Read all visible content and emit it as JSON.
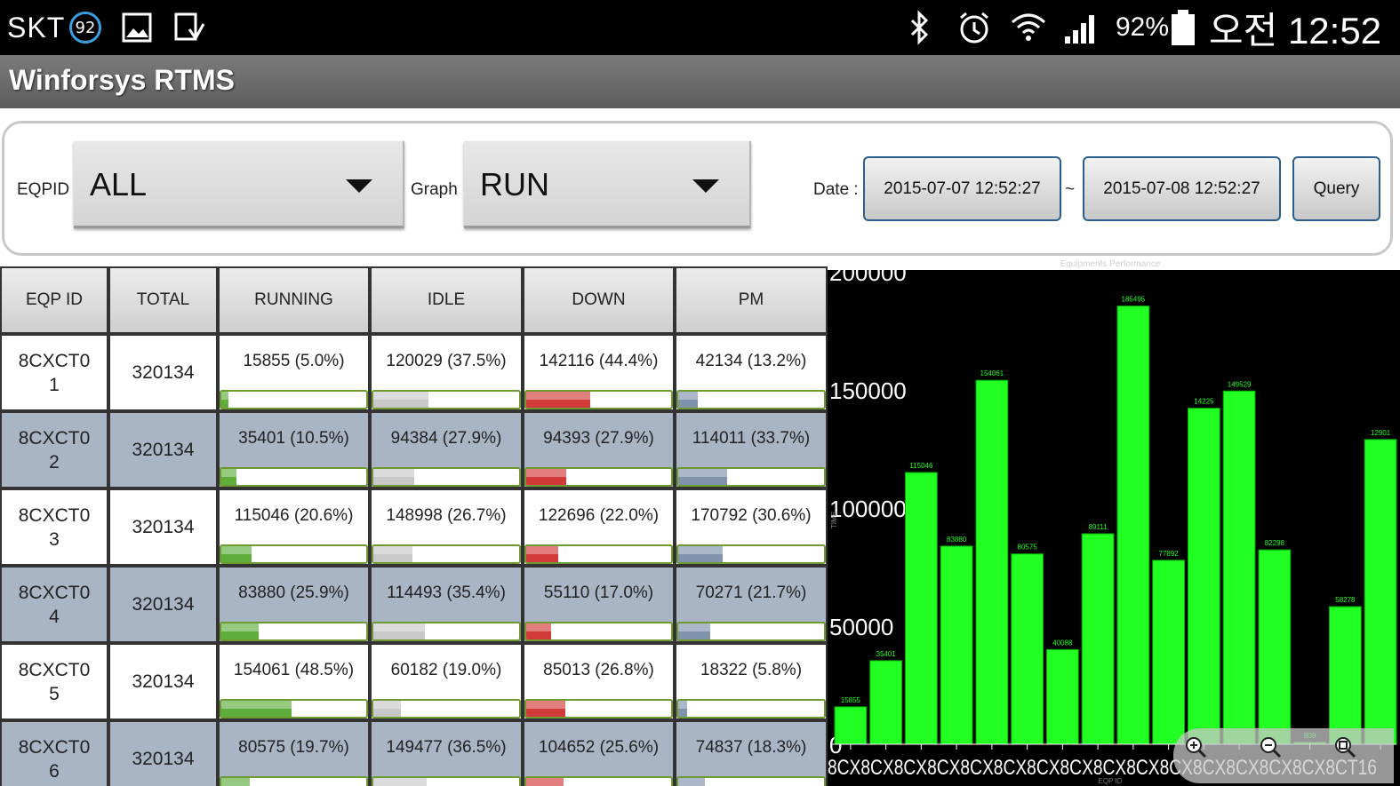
{
  "status_bar": {
    "carrier": "SKT",
    "badge": "92",
    "battery_text": "92%",
    "time": "오전 12:52",
    "icons": [
      "gallery-icon",
      "download-icon",
      "bluetooth-icon",
      "alarm-icon",
      "wifi-icon",
      "signal-icon",
      "battery-icon"
    ]
  },
  "app": {
    "title": "Winforsys RTMS"
  },
  "filters": {
    "eqpid_label": "EQPID",
    "eqpid_value": "ALL",
    "graph_label": "Graph",
    "graph_value": "RUN",
    "date_label": "Date :",
    "date_from": "2015-07-07 12:52:27",
    "date_sep": "~",
    "date_to": "2015-07-08 12:52:27",
    "query_label": "Query"
  },
  "table": {
    "headers": [
      "EQP ID",
      "TOTAL",
      "RUNNING",
      "IDLE",
      "DOWN",
      "PM"
    ],
    "bar_colors": {
      "running": "#5fae3c",
      "idle": "#c8c8c8",
      "down": "#d23a3a",
      "pm": "#7f93ad"
    },
    "rows": [
      {
        "id_a": "8CXCT0",
        "id_b": "1",
        "total": "320134",
        "running": "15855 (5.0%)",
        "idle": "120029 (37.5%)",
        "down": "142116 (44.4%)",
        "pm": "42134 (13.2%)",
        "fill": {
          "running": 5.0,
          "idle": 37.5,
          "down": 44.4,
          "pm": 13.2
        }
      },
      {
        "id_a": "8CXCT0",
        "id_b": "2",
        "total": "320134",
        "running": "35401 (10.5%)",
        "idle": "94384 (27.9%)",
        "down": "94393 (27.9%)",
        "pm": "114011 (33.7%)",
        "fill": {
          "running": 10.5,
          "idle": 27.9,
          "down": 27.9,
          "pm": 33.7
        }
      },
      {
        "id_a": "8CXCT0",
        "id_b": "3",
        "total": "320134",
        "running": "115046 (20.6%)",
        "idle": "148998 (26.7%)",
        "down": "122696 (22.0%)",
        "pm": "170792 (30.6%)",
        "fill": {
          "running": 20.6,
          "idle": 26.7,
          "down": 22.0,
          "pm": 30.6
        }
      },
      {
        "id_a": "8CXCT0",
        "id_b": "4",
        "total": "320134",
        "running": "83880 (25.9%)",
        "idle": "114493 (35.4%)",
        "down": "55110 (17.0%)",
        "pm": "70271 (21.7%)",
        "fill": {
          "running": 25.9,
          "idle": 35.4,
          "down": 17.0,
          "pm": 21.7
        }
      },
      {
        "id_a": "8CXCT0",
        "id_b": "5",
        "total": "320134",
        "running": "154061 (48.5%)",
        "idle": "60182 (19.0%)",
        "down": "85013 (26.8%)",
        "pm": "18322 (5.8%)",
        "fill": {
          "running": 48.5,
          "idle": 19.0,
          "down": 26.8,
          "pm": 5.8
        }
      },
      {
        "id_a": "8CXCT0",
        "id_b": "6",
        "total": "320134",
        "running": "80575 (19.7%)",
        "idle": "149477 (36.5%)",
        "down": "104652 (25.6%)",
        "pm": "74837 (18.3%)",
        "fill": {
          "running": 19.7,
          "idle": 36.5,
          "down": 25.6,
          "pm": 18.3
        }
      }
    ]
  },
  "chart_data": {
    "type": "bar",
    "title": "Equipments Performance",
    "xlabel": "EQP ID",
    "ylabel": "TIME",
    "ylim": [
      0,
      200000
    ],
    "yticks": [
      "0",
      "50000",
      "100000",
      "150000",
      "200000"
    ],
    "bar_color": "#22ff22",
    "background": "#000000",
    "x_tick_text": "8CX8CX8CX8CX8CX8CX8CX8CX8CX8CX8CX8CX8CX8CX8CX8CT16",
    "values": [
      15855,
      35401,
      115046,
      83880,
      154061,
      80575,
      40088,
      89111,
      185495,
      77892,
      142250,
      149529,
      82298,
      809,
      58278,
      129011
    ],
    "labels": [
      "15855",
      "35401",
      "115046",
      "83880",
      "154061",
      "80575",
      "40088",
      "89111",
      "185495",
      "77892",
      "14225",
      "149529",
      "82298",
      "809",
      "58278",
      "12901"
    ]
  }
}
